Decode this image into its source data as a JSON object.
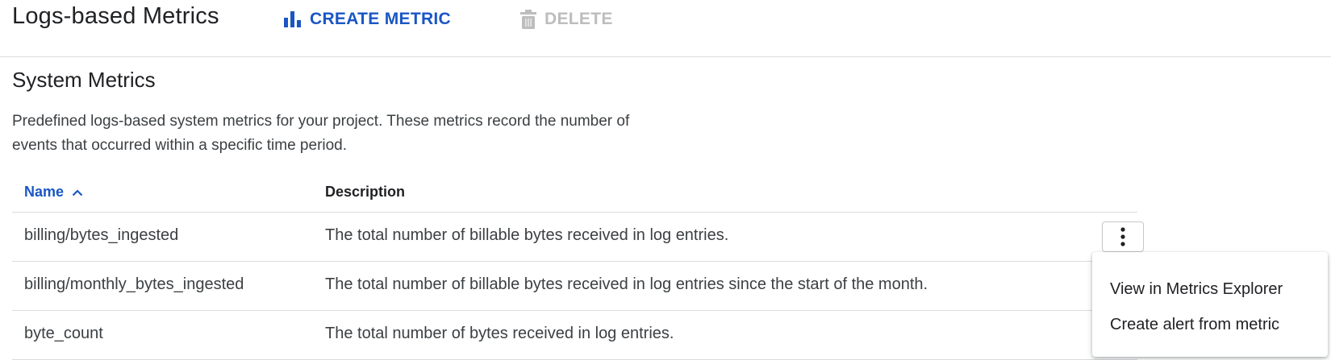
{
  "header": {
    "title": "Logs-based Metrics",
    "create_label": "CREATE METRIC",
    "delete_label": "DELETE",
    "create_icon": "bar-chart-icon",
    "delete_icon": "trash-icon"
  },
  "section": {
    "title": "System Metrics",
    "description": "Predefined logs-based system metrics for your project. These metrics record the number of events that occurred within a specific time period."
  },
  "table": {
    "columns": [
      "Name",
      "Description"
    ],
    "sort_column": "Name",
    "sort_direction": "ascending",
    "rows": [
      {
        "name": "billing/bytes_ingested",
        "description": "The total number of billable bytes received in log entries."
      },
      {
        "name": "billing/monthly_bytes_ingested",
        "description": "The total number of billable bytes received in log entries since the start of the month."
      },
      {
        "name": "byte_count",
        "description": "The total number of bytes received in log entries."
      }
    ]
  },
  "context_menu": {
    "items": [
      "View in Metrics Explorer",
      "Create alert from metric"
    ]
  },
  "colors": {
    "accent": "#1a56c4",
    "disabled": "#bdbdbd",
    "divider": "#dadce0"
  }
}
